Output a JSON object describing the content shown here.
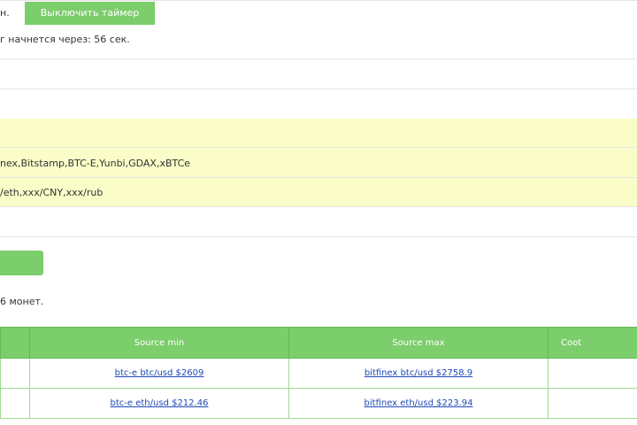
{
  "timer": {
    "status_fragment": "н.",
    "button_label": "Выключить таймер",
    "countdown_text": "г начнется через: 56 сек."
  },
  "filters": {
    "exchanges_fragment": "nex,Bitstamp,BTC-E,Yunbi,GDAX,xBTCe",
    "pairs_fragment": "/eth,xxx/CNY,xxx/rub"
  },
  "summary": {
    "coins_fragment": "6 монет."
  },
  "table": {
    "headers": [
      "Source min",
      "Source max",
      "Coot"
    ],
    "rows": [
      {
        "min_link": "btc-e btc/usd $2609",
        "max_link": "bitfinex btc/usd $2758.9"
      },
      {
        "min_link": "btc-e eth/usd $212.46",
        "max_link": "bitfinex eth/usd $223.94"
      }
    ]
  },
  "colors": {
    "accent_green": "#7ccd6b",
    "highlight_yellow": "#fbfdc8",
    "link_blue": "#1e49b8"
  }
}
